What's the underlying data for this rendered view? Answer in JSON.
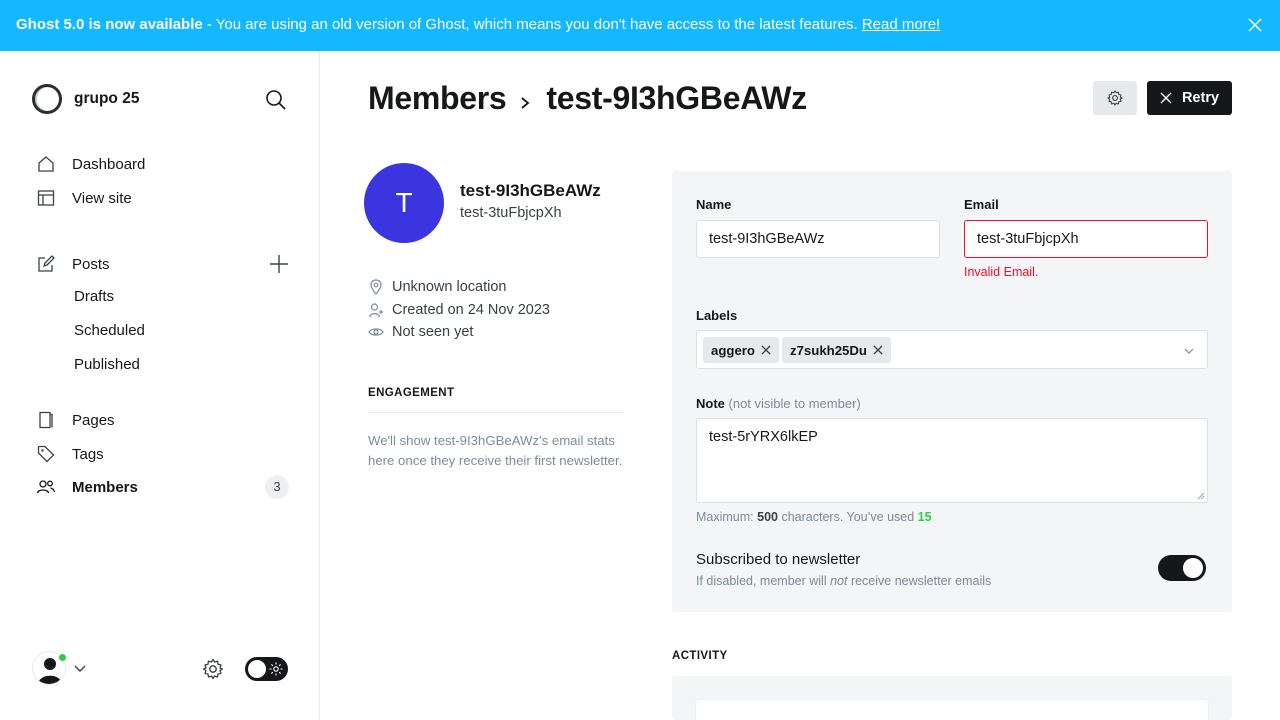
{
  "banner": {
    "bold": "Ghost 5.0 is now available",
    "message": " - You are using an old version of Ghost, which means you don't have access to the latest features. ",
    "link": "Read more!"
  },
  "sidebar": {
    "site_name": "grupo 25",
    "nav": {
      "dashboard": "Dashboard",
      "view_site": "View site",
      "posts": "Posts",
      "drafts": "Drafts",
      "scheduled": "Scheduled",
      "published": "Published",
      "pages": "Pages",
      "tags": "Tags",
      "members": "Members",
      "members_count": "3"
    }
  },
  "header": {
    "breadcrumb_parent": "Members",
    "breadcrumb_current": "test-9I3hGBeAWz",
    "retry_label": "Retry"
  },
  "member": {
    "initial": "T",
    "name": "test-9I3hGBeAWz",
    "email": "test-3tuFbjcpXh",
    "location": "Unknown location",
    "created": "Created on 24 Nov 2023",
    "last_seen": "Not seen yet"
  },
  "engagement": {
    "title": "ENGAGEMENT",
    "text": "We'll show test-9I3hGBeAWz's email stats here once they receive their first newsletter."
  },
  "form": {
    "name_label": "Name",
    "name_value": "test-9I3hGBeAWz",
    "email_label": "Email",
    "email_value": "test-3tuFbjcpXh",
    "email_error": "Invalid Email.",
    "labels_label": "Labels",
    "labels": [
      "aggero",
      "z7sukh25Du"
    ],
    "note_label": "Note",
    "note_muted": "(not visible to member)",
    "note_value": "test-5rYRX6lkEP",
    "hint_prefix": "Maximum: ",
    "hint_max": "500",
    "hint_mid": " characters. You’ve used ",
    "hint_used": "15",
    "subscribed_title": "Subscribed to newsletter",
    "subscribed_desc_1": "If disabled, member will ",
    "subscribed_desc_em": "not",
    "subscribed_desc_2": " receive newsletter emails",
    "subscribed": true
  },
  "activity": {
    "title": "ACTIVITY"
  },
  "colors": {
    "banner": "#14b8ff",
    "accent": "#3b35e0",
    "error": "#f50b23",
    "success": "#30cf43",
    "dark": "#15171a"
  },
  "icons": [
    "close-icon",
    "search-icon",
    "home-icon",
    "browser-icon",
    "edit-icon",
    "plus-icon",
    "page-icon",
    "tag-icon",
    "users-icon",
    "chevron-down-icon",
    "gear-icon",
    "sun-icon",
    "chevron-right-icon",
    "location-pin-icon",
    "user-add-icon",
    "eye-icon"
  ]
}
